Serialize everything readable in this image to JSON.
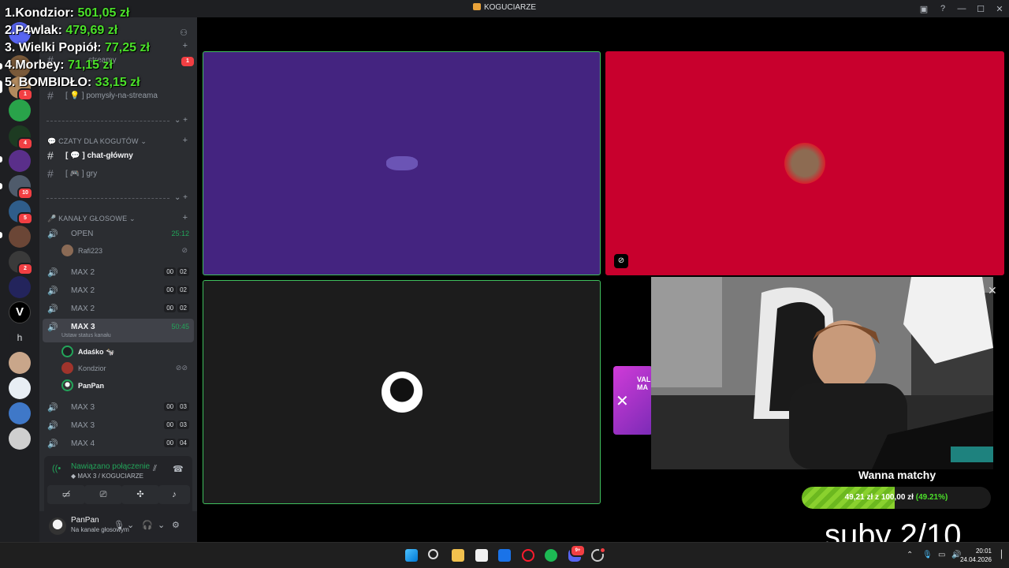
{
  "window": {
    "title": "KOGUCIARZE"
  },
  "overlay": {
    "ranking": [
      {
        "label": "1.Kondzior: ",
        "amount": "501,05 zł"
      },
      {
        "label": "2.P4wlak: ",
        "amount": "479,69 zł"
      },
      {
        "label": "3. Wielki Popiół: ",
        "amount": "77,25 zł"
      },
      {
        "label": "4.Morbey: ",
        "amount": "71,15 zł"
      },
      {
        "label": "5. BOMBIDŁO: ",
        "amount": "33,15 zł"
      }
    ],
    "goal": {
      "title": "Wanna matchy",
      "current": "49,21 zł",
      "sep": "z",
      "target": "100,00 zł",
      "percent_label": "(49.21%)",
      "fraction": 0.4921
    },
    "subs": "suby 2/10",
    "promo_text": "VAL MA"
  },
  "rail": {
    "badges": [
      "1",
      "4",
      "10",
      "5",
      "2"
    ],
    "letter_server": "h"
  },
  "channels": {
    "text": [
      {
        "label": "[ 💡 ] pomysły-na-streama"
      },
      {
        "label": "[ 💬 ] chat-główny"
      },
      {
        "label": "[ 🎮 ] gry"
      },
      {
        "label": "streamy"
      }
    ],
    "cat_chats": "💬 CZATY DLA KOGUTÓW",
    "cat_voice": "🎤 KANAŁY GŁOSOWE",
    "voice": [
      {
        "label": "OPEN",
        "time": "25:12"
      },
      {
        "label": "MAX 2",
        "c1": "00",
        "c2": "02"
      },
      {
        "label": "MAX 2",
        "c1": "00",
        "c2": "02"
      },
      {
        "label": "MAX 2",
        "c1": "00",
        "c2": "02"
      },
      {
        "label": "MAX 3",
        "time": "50:45",
        "status": "Ustaw status kanału"
      },
      {
        "label": "MAX 3",
        "c1": "00",
        "c2": "03"
      },
      {
        "label": "MAX 3",
        "c1": "00",
        "c2": "03"
      },
      {
        "label": "MAX 4",
        "c1": "00",
        "c2": "04"
      }
    ],
    "open_user": "Rafi223",
    "max3_users": [
      "Adaśko 🐄",
      "Kondzior",
      "PanPan"
    ]
  },
  "voice_panel": {
    "connected": "Nawiązano połączenie",
    "location": "MAX 3 / KOGUCIARZE"
  },
  "user": {
    "name": "PanPan",
    "status": "Na kanale głosowym"
  },
  "taskbar": {
    "time": "20:01",
    "date": "24.04.2026",
    "discord_badge": "9+"
  },
  "colors": {
    "accent_green": "#23a55a",
    "tile_purple": "#442480",
    "tile_red": "#c8002d",
    "money_green": "#4be02a"
  }
}
